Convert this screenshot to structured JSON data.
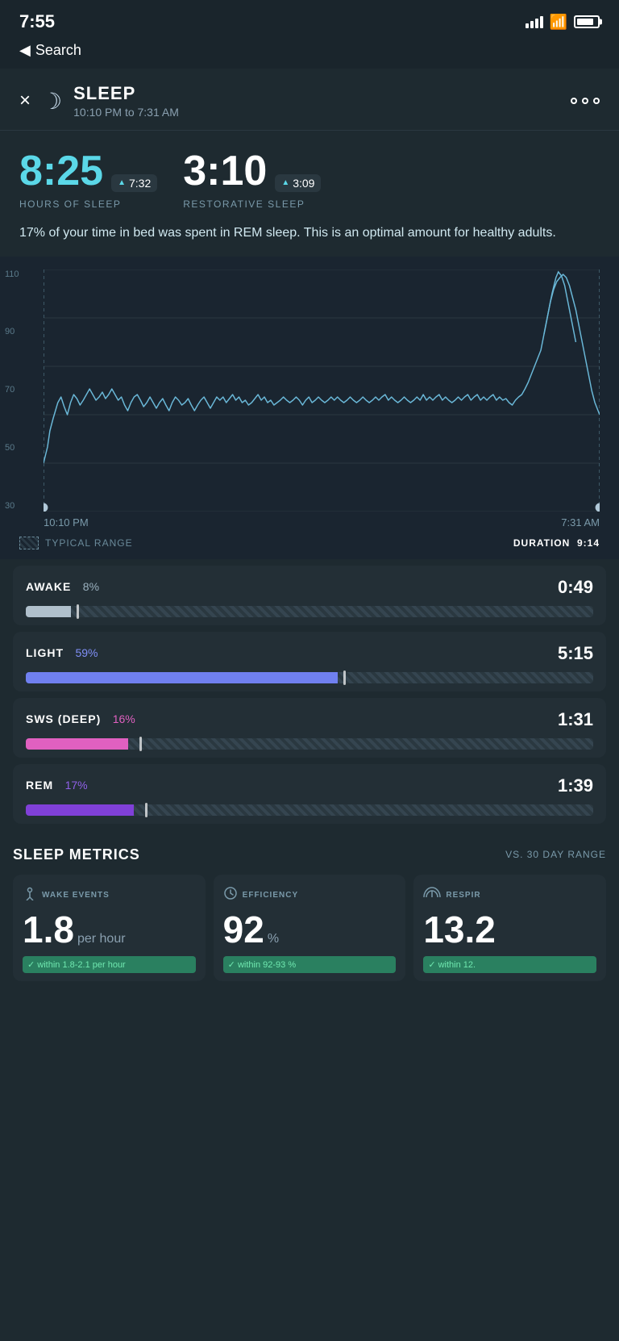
{
  "statusBar": {
    "time": "7:55",
    "backLabel": "Search"
  },
  "header": {
    "title": "SLEEP",
    "timeRange": "10:10 PM to 7:31 AM",
    "closeLabel": "×",
    "moreLabel": "···"
  },
  "stats": {
    "hoursOfSleep": "8:25",
    "hoursAvg": "7:32",
    "restorativeSleep": "3:10",
    "restorativeAvg": "3:09",
    "hoursLabel": "HOURS OF SLEEP",
    "restorativeLabel": "RESTORATIVE SLEEP",
    "remNote": "17% of your time in bed was spent in REM sleep. This is an optimal amount for healthy adults."
  },
  "chart": {
    "yLabels": [
      "110",
      "90",
      "70",
      "50",
      "30"
    ],
    "startTime": "10:10 PM",
    "endTime": "7:31 AM",
    "typicalRange": "TYPICAL RANGE",
    "durationLabel": "DURATION",
    "durationValue": "9:14"
  },
  "stages": [
    {
      "name": "AWAKE",
      "pct": "8%",
      "pctClass": "gray",
      "time": "0:49",
      "fillClass": "awake",
      "fillWidth": "8",
      "markerPos": "9"
    },
    {
      "name": "LIGHT",
      "pct": "59%",
      "pctClass": "blue",
      "time": "5:15",
      "fillClass": "light",
      "fillWidth": "55",
      "markerPos": "56"
    },
    {
      "name": "SWS (DEEP)",
      "pct": "16%",
      "pctClass": "pink",
      "time": "1:31",
      "fillClass": "deep",
      "fillWidth": "18",
      "markerPos": "20"
    },
    {
      "name": "REM",
      "pct": "17%",
      "pctClass": "purple",
      "time": "1:39",
      "fillClass": "rem",
      "fillWidth": "19",
      "markerPos": "21"
    }
  ],
  "metricsSection": {
    "title": "SLEEP METRICS",
    "subtitle": "VS. 30 DAY RANGE",
    "cards": [
      {
        "iconLabel": "wake-events-icon",
        "label": "WAKE EVENTS",
        "bigValue": "1.8",
        "unit": "per hour",
        "footerText": "✓ within 1.8-2.1 per hour"
      },
      {
        "iconLabel": "efficiency-icon",
        "label": "EFFICIENCY",
        "bigValue": "92",
        "unit": "%",
        "footerText": "✓ within 92-93 %"
      },
      {
        "iconLabel": "respiration-icon",
        "label": "RESPIR",
        "bigValue": "13.2",
        "unit": "",
        "footerText": "✓ within 12."
      }
    ]
  }
}
